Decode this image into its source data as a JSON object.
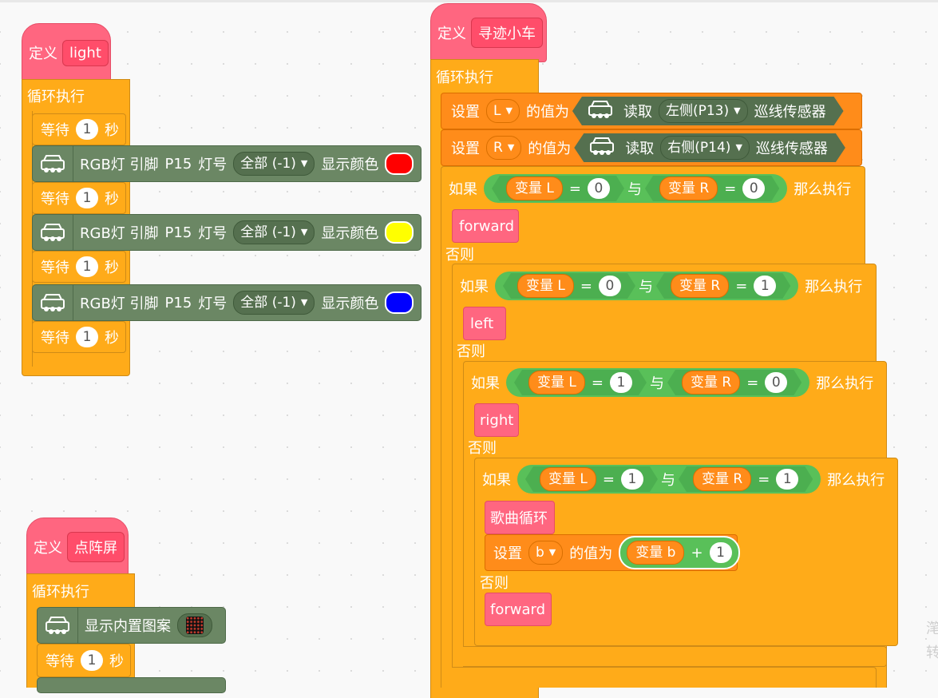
{
  "colors": {
    "control": "#ffab19",
    "procedure": "#ff6680",
    "extension": "#6b8764",
    "operator": "#59c059",
    "variable": "#ff8c1a",
    "red": "#ff0000",
    "yellow": "#ffff00",
    "blue": "#0000ff"
  },
  "icons": [
    "robot-car-icon",
    "led-matrix-icon",
    "dropdown-caret-icon"
  ],
  "common": {
    "define": "定义",
    "forever": "循环执行",
    "wait": "等待",
    "seconds": "秒",
    "set": "设置",
    "value_of": "的值为",
    "if": "如果",
    "then": "那么执行",
    "else": "否则",
    "and": "与",
    "eq": "=",
    "plus": "+",
    "read": "读取",
    "sensor": "巡线传感器",
    "rgb": "RGB灯 引脚",
    "pin": "P15",
    "led_no": "灯号",
    "all": "全部 (-1)",
    "show_color": "显示颜色",
    "show_pattern": "显示内置图案"
  },
  "procedures": {
    "light": "light",
    "track_car": "寻迹小车",
    "dot_matrix": "点阵屏"
  },
  "vars": {
    "L": "L",
    "R": "R",
    "b": "b",
    "var_L": "变量 L",
    "var_R": "变量 R",
    "var_b": "变量 b"
  },
  "sensors": {
    "left": "左侧(P13)",
    "right": "右侧(P14)"
  },
  "calls": {
    "forward": "forward",
    "left": "left",
    "right": "right",
    "song": "歌曲循环"
  },
  "numbers": {
    "zero": "0",
    "one": "1"
  },
  "edge_text": [
    "滗",
    "转"
  ]
}
